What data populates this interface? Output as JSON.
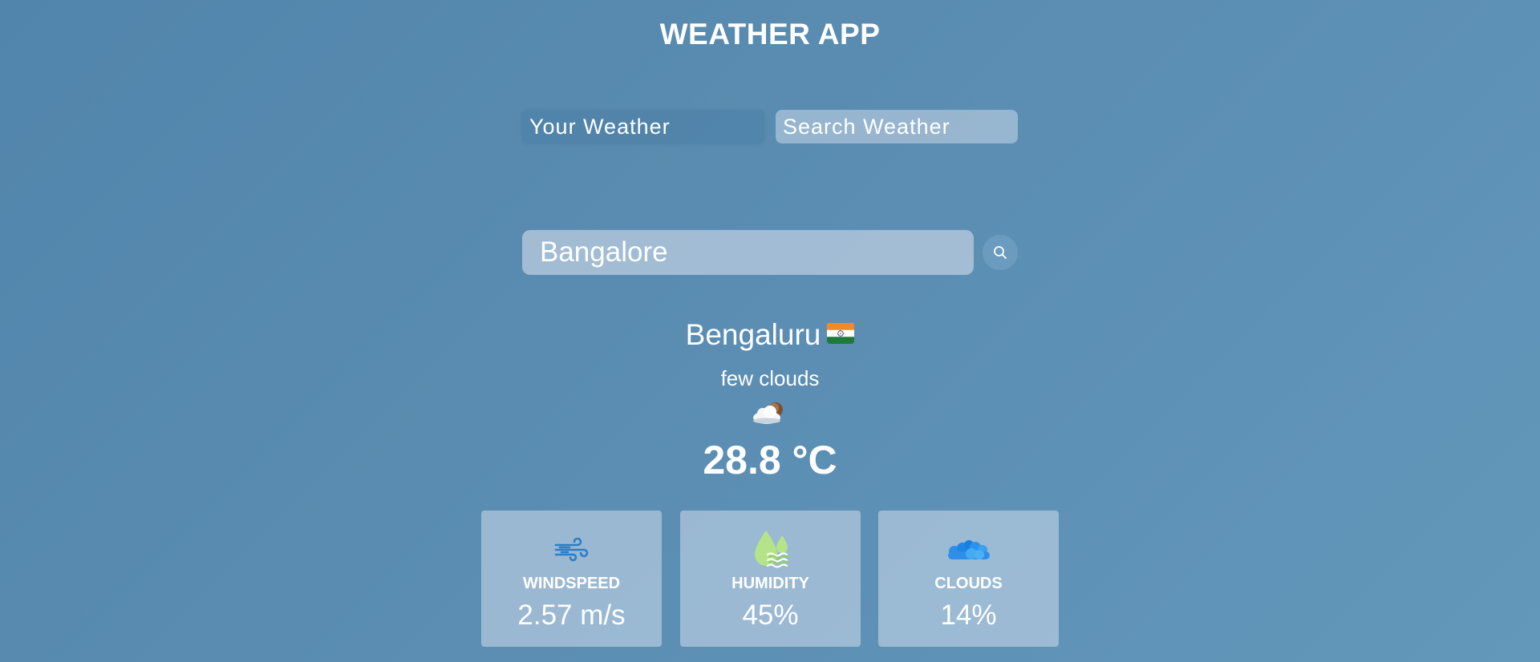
{
  "app": {
    "title": "WEATHER APP"
  },
  "tabs": [
    {
      "label": "Your Weather",
      "active": false
    },
    {
      "label": "Search Weather",
      "active": true
    }
  ],
  "search": {
    "value": "Bangalore",
    "button_icon": "search-icon"
  },
  "weather": {
    "city": "Bengaluru",
    "country_flag": "india-flag-icon",
    "description": "few clouds",
    "condition_icon": "few-clouds-icon",
    "temperature": "28.8 °C"
  },
  "stats": [
    {
      "label": "WINDSPEED",
      "value": "2.57 m/s",
      "icon": "wind-icon"
    },
    {
      "label": "HUMIDITY",
      "value": "45%",
      "icon": "humidity-icon"
    },
    {
      "label": "CLOUDS",
      "value": "14%",
      "icon": "clouds-icon"
    }
  ],
  "colors": {
    "background": "#5a8cb1",
    "text": "#ffffff",
    "humidity_green": "#b5e38a",
    "clouds_blue": "#1e8cf0",
    "wind_blue": "#2a7fc9"
  }
}
